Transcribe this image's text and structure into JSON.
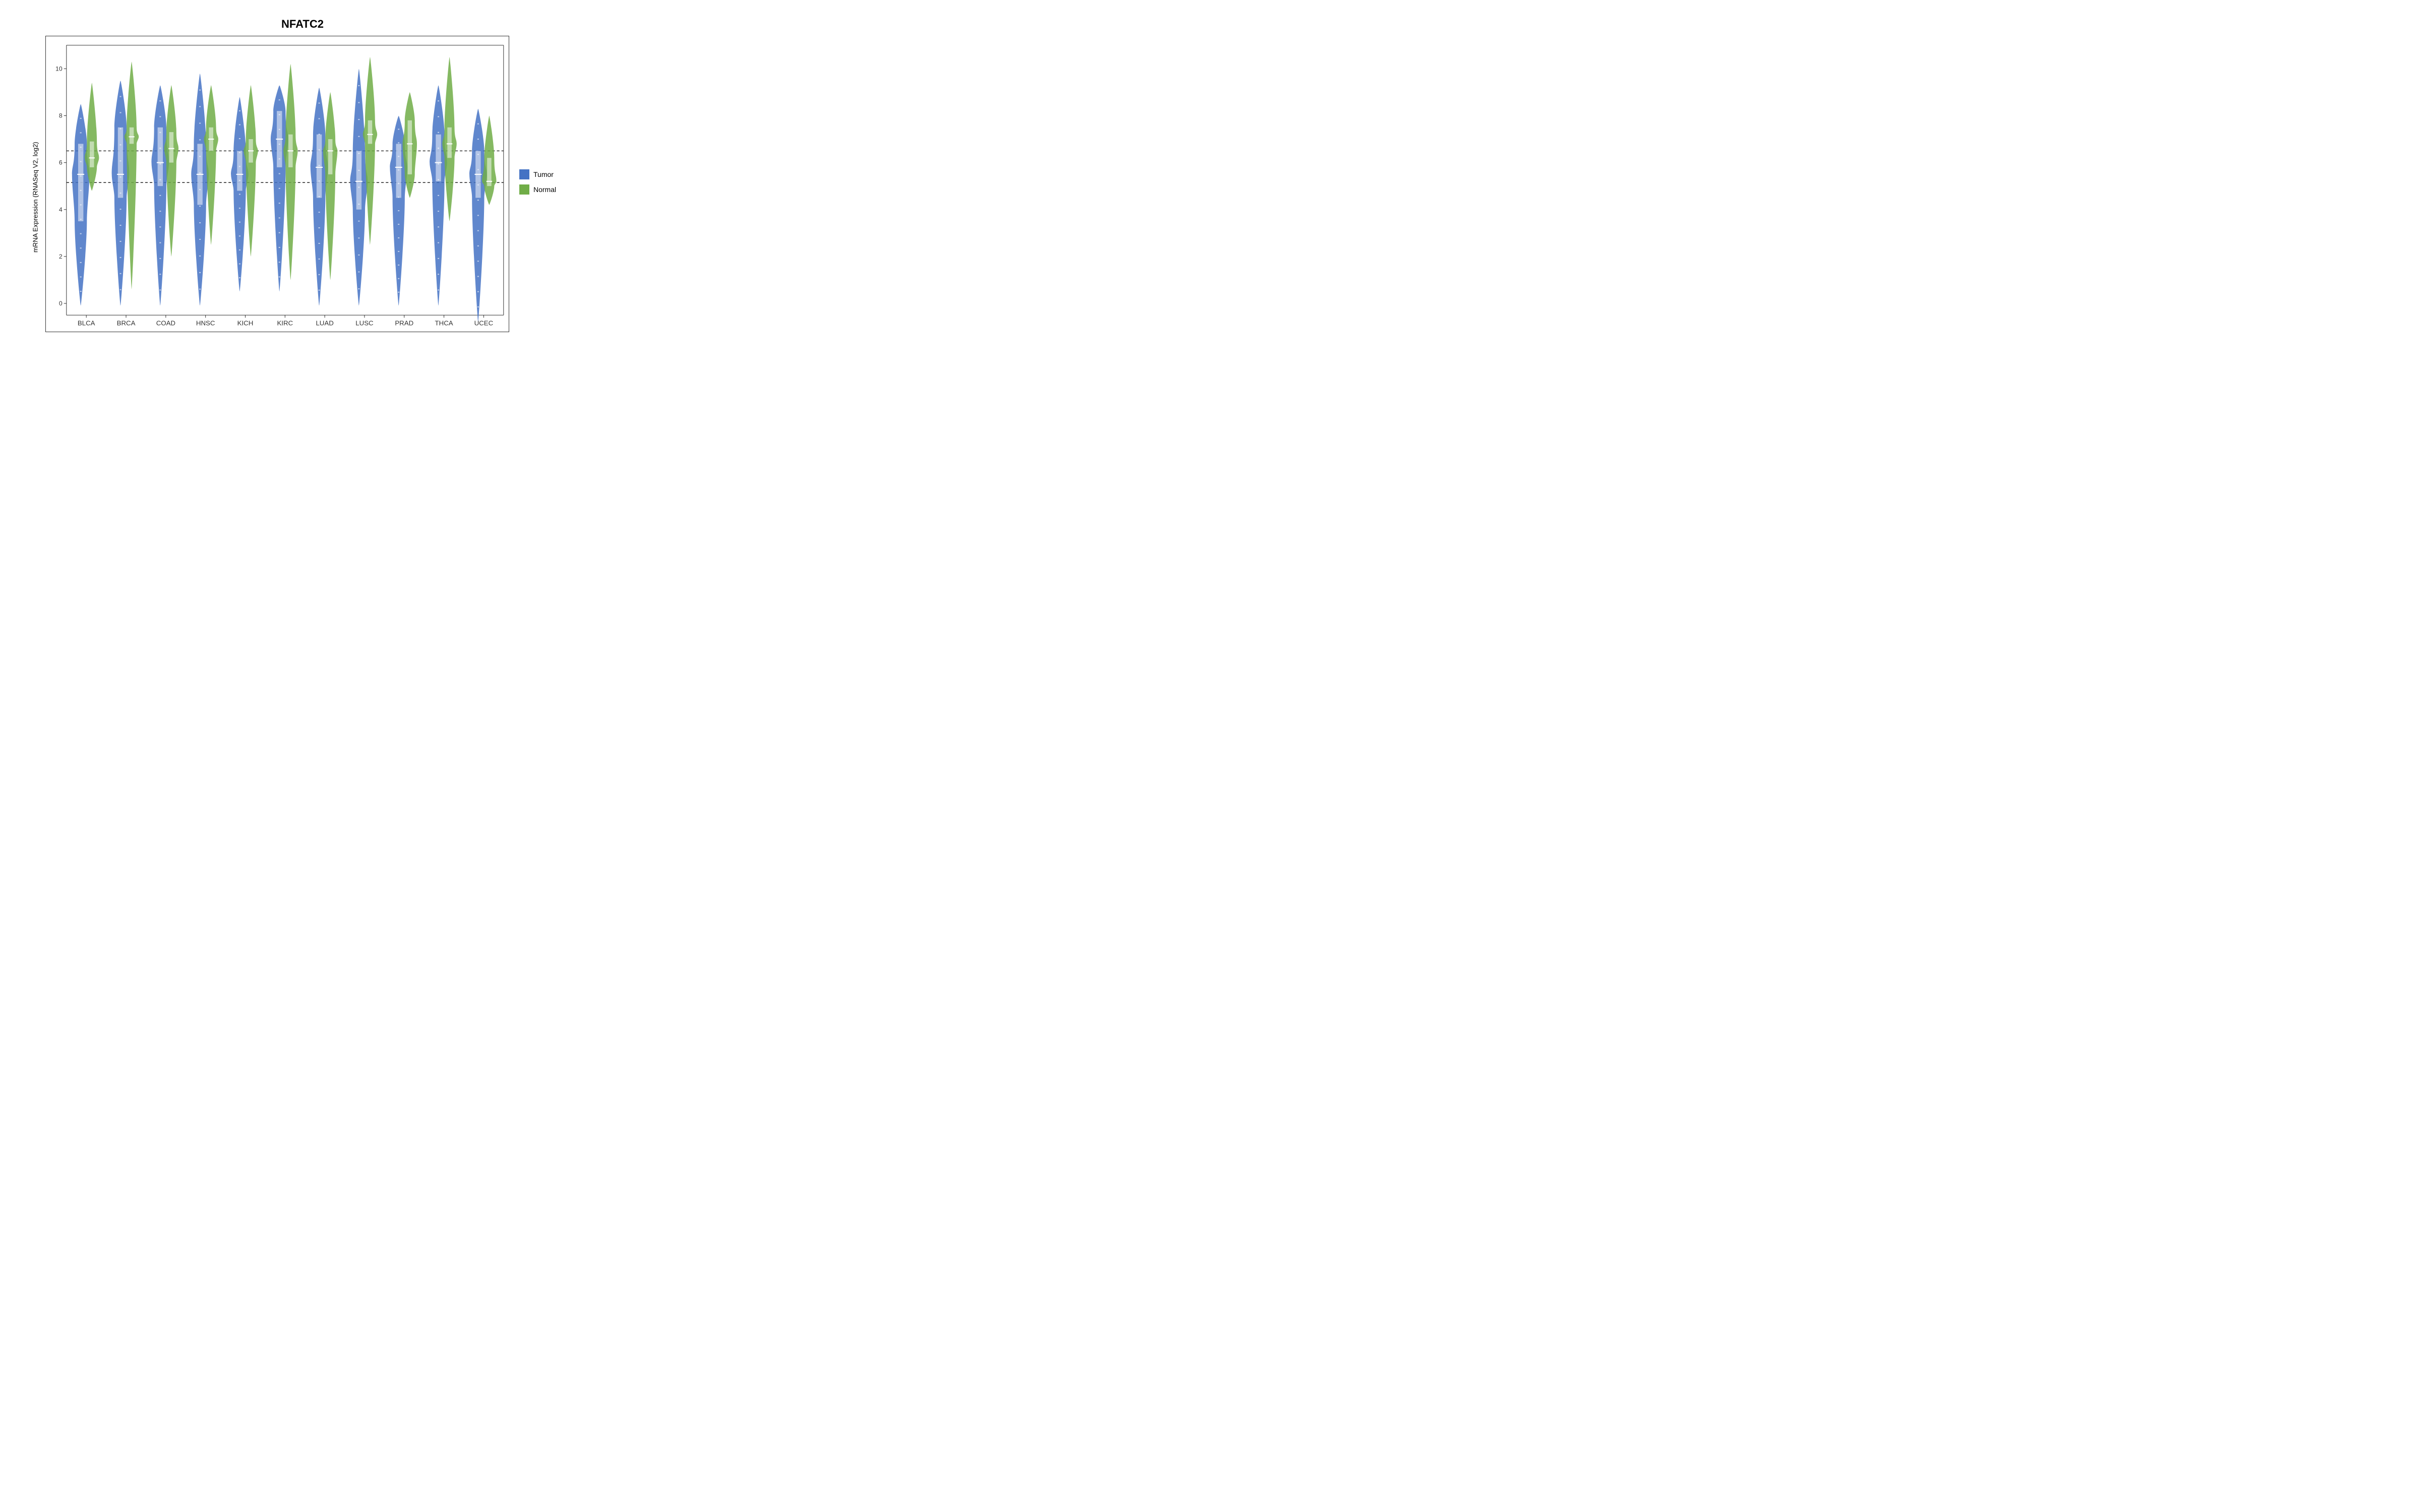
{
  "title": "NFATC2",
  "yAxisLabel": "mRNA Expression (RNASeq V2, log2)",
  "yAxisTicks": [
    0,
    2,
    4,
    6,
    8,
    10
  ],
  "dottedLines": [
    5.15,
    6.5
  ],
  "cancerTypes": [
    "BLCA",
    "BRCA",
    "COAD",
    "HNSC",
    "KICH",
    "KIRC",
    "LUAD",
    "LUSC",
    "PRAD",
    "THCA",
    "UCEC"
  ],
  "legend": {
    "tumor": {
      "label": "Tumor",
      "color": "#4472C4"
    },
    "normal": {
      "label": "Normal",
      "color": "#70AD47"
    }
  },
  "colors": {
    "tumor": "#4472C4",
    "normal": "#70AD47",
    "tumorLight": "#6fa0e8",
    "normalLight": "#92c75a"
  },
  "violinData": [
    {
      "name": "BLCA",
      "tumor": {
        "min": -0.1,
        "q1": 3.5,
        "median": 5.5,
        "q3": 6.8,
        "max": 8.5,
        "width": 0.55,
        "shape": "tall-wide"
      },
      "normal": {
        "min": 4.8,
        "q1": 5.8,
        "median": 6.2,
        "q3": 6.9,
        "max": 9.4,
        "width": 0.4,
        "shape": "top-heavy"
      }
    },
    {
      "name": "BRCA",
      "tumor": {
        "min": -0.1,
        "q1": 4.5,
        "median": 5.5,
        "q3": 7.5,
        "max": 9.5,
        "width": 0.6,
        "shape": "bimodal"
      },
      "normal": {
        "min": 0.6,
        "q1": 6.8,
        "median": 7.1,
        "q3": 7.5,
        "max": 10.3,
        "width": 0.45,
        "shape": "top-heavy"
      }
    },
    {
      "name": "COAD",
      "tumor": {
        "min": -0.1,
        "q1": 5.0,
        "median": 6.0,
        "q3": 7.5,
        "max": 9.3,
        "width": 0.5,
        "shape": "normal"
      },
      "normal": {
        "min": 2.0,
        "q1": 6.0,
        "median": 6.6,
        "q3": 7.3,
        "max": 9.3,
        "width": 0.42,
        "shape": "normal"
      }
    },
    {
      "name": "HNSC",
      "tumor": {
        "min": -0.1,
        "q1": 4.2,
        "median": 5.5,
        "q3": 6.8,
        "max": 9.8,
        "width": 0.55,
        "shape": "tall-wide"
      },
      "normal": {
        "min": 2.5,
        "q1": 6.5,
        "median": 7.0,
        "q3": 7.5,
        "max": 9.3,
        "width": 0.4,
        "shape": "top-heavy"
      }
    },
    {
      "name": "KICH",
      "tumor": {
        "min": 0.5,
        "q1": 4.8,
        "median": 5.5,
        "q3": 6.5,
        "max": 8.8,
        "width": 0.5,
        "shape": "normal"
      },
      "normal": {
        "min": 2.0,
        "q1": 6.0,
        "median": 6.5,
        "q3": 7.0,
        "max": 9.3,
        "width": 0.38,
        "shape": "normal"
      }
    },
    {
      "name": "KIRC",
      "tumor": {
        "min": 0.5,
        "q1": 5.8,
        "median": 7.0,
        "q3": 8.2,
        "max": 9.3,
        "width": 0.6,
        "shape": "normal"
      },
      "normal": {
        "min": 1.0,
        "q1": 5.8,
        "median": 6.5,
        "q3": 7.2,
        "max": 10.2,
        "width": 0.42,
        "shape": "normal"
      }
    },
    {
      "name": "LUAD",
      "tumor": {
        "min": -0.1,
        "q1": 4.5,
        "median": 5.8,
        "q3": 7.2,
        "max": 9.2,
        "width": 0.55,
        "shape": "normal"
      },
      "normal": {
        "min": 1.0,
        "q1": 5.5,
        "median": 6.5,
        "q3": 7.0,
        "max": 9.0,
        "width": 0.4,
        "shape": "normal"
      }
    },
    {
      "name": "LUSC",
      "tumor": {
        "min": -0.1,
        "q1": 4.0,
        "median": 5.2,
        "q3": 6.5,
        "max": 10.0,
        "width": 0.55,
        "shape": "tall-wide"
      },
      "normal": {
        "min": 2.5,
        "q1": 6.8,
        "median": 7.2,
        "q3": 7.8,
        "max": 10.5,
        "width": 0.45,
        "shape": "top-heavy"
      }
    },
    {
      "name": "PRAD",
      "tumor": {
        "min": -0.1,
        "q1": 4.5,
        "median": 5.8,
        "q3": 6.8,
        "max": 8.0,
        "width": 0.5,
        "shape": "normal"
      },
      "normal": {
        "min": 4.5,
        "q1": 5.5,
        "median": 6.8,
        "q3": 7.8,
        "max": 9.0,
        "width": 0.4,
        "shape": "normal"
      }
    },
    {
      "name": "THCA",
      "tumor": {
        "min": -0.1,
        "q1": 5.2,
        "median": 6.0,
        "q3": 7.2,
        "max": 9.3,
        "width": 0.55,
        "shape": "normal"
      },
      "normal": {
        "min": 3.5,
        "q1": 6.2,
        "median": 6.8,
        "q3": 7.5,
        "max": 10.5,
        "width": 0.42,
        "shape": "normal"
      }
    },
    {
      "name": "UCEC",
      "tumor": {
        "min": -0.8,
        "q1": 4.5,
        "median": 5.5,
        "q3": 6.5,
        "max": 8.3,
        "width": 0.5,
        "shape": "normal"
      },
      "normal": {
        "min": 4.2,
        "q1": 5.0,
        "median": 5.2,
        "q3": 6.2,
        "max": 8.0,
        "width": 0.38,
        "shape": "top-heavy"
      }
    }
  ]
}
